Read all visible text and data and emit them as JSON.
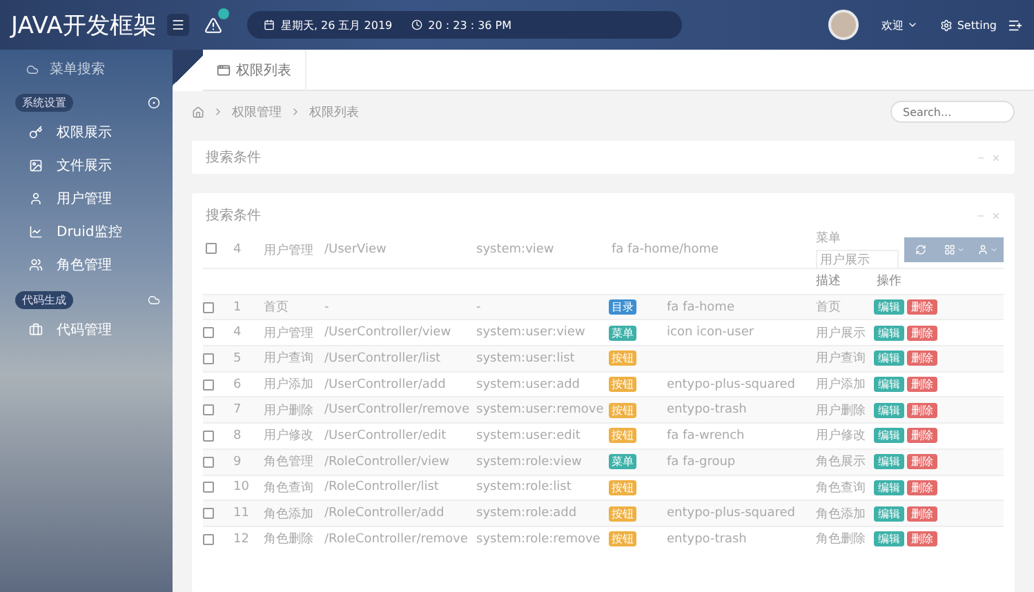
{
  "topbar": {
    "logo": "JAVA开发框架",
    "date": "星期天, 26 五月 2019",
    "time": "20 : 23 : 36 PM",
    "greeting": "欢迎",
    "setting": "Setting"
  },
  "sidebar": {
    "search_label": "菜单搜索",
    "sections": [
      {
        "title": "系统设置",
        "items": [
          {
            "label": "权限展示"
          },
          {
            "label": "文件展示"
          },
          {
            "label": "用户管理"
          },
          {
            "label": "Druid监控"
          },
          {
            "label": "角色管理"
          }
        ]
      },
      {
        "title": "代码生成",
        "items": [
          {
            "label": "代码管理"
          }
        ]
      }
    ]
  },
  "tab": "权限列表",
  "breadcrumb": [
    "权限管理",
    "权限列表"
  ],
  "search": {
    "placeholder": "Search..."
  },
  "panels": [
    "搜索条件",
    "搜索条件"
  ],
  "table": {
    "floating_row": [
      "4",
      "用户管理",
      "/UserView",
      "system:view",
      "fa fa-home/home"
    ],
    "floating_checked": false,
    "menu_label": "菜单",
    "menu_value": "用户展示",
    "columns": [
      "描述",
      "操作"
    ],
    "rows": [
      {
        "id": "1",
        "checked": false,
        "name": "首页",
        "url": "-",
        "perms": "-",
        "type": {
          "label": "目录",
          "kind": "dir"
        },
        "icon": "fa fa-home",
        "desc": "首页",
        "actions": [
          "编辑",
          "删除"
        ]
      },
      {
        "id": "4",
        "checked": false,
        "name": "用户管理",
        "url": "/UserController/view",
        "perms": "system:user:view",
        "type": {
          "label": "菜单",
          "kind": "menu"
        },
        "icon": "icon icon-user",
        "desc": "用户展示",
        "actions": [
          "编辑",
          "删除"
        ]
      },
      {
        "id": "5",
        "checked": false,
        "name": "用户查询",
        "url": "/UserController/list",
        "perms": "system:user:list",
        "type": {
          "label": "按钮",
          "kind": "button"
        },
        "desc": "用户查询",
        "actions": [
          "编辑",
          "删除"
        ]
      },
      {
        "id": "6",
        "checked": false,
        "name": "用户添加",
        "url": "/UserController/add",
        "perms": "system:user:add",
        "type": {
          "label": "按钮",
          "kind": "button"
        },
        "icon": "entypo-plus-squared",
        "desc": "用户添加",
        "actions": [
          "编辑",
          "删除"
        ]
      },
      {
        "id": "7",
        "checked": false,
        "name": "用户删除",
        "url": "/UserController/remove",
        "perms": "system:user:remove",
        "type": {
          "label": "按钮",
          "kind": "button"
        },
        "icon": "entypo-trash",
        "desc": "用户删除",
        "actions": [
          "编辑",
          "删除"
        ]
      },
      {
        "id": "8",
        "checked": false,
        "name": "用户修改",
        "url": "/UserController/edit",
        "perms": "system:user:edit",
        "type": {
          "label": "按钮",
          "kind": "button"
        },
        "icon": "fa fa-wrench",
        "desc": "用户修改",
        "actions": [
          "编辑",
          "删除"
        ]
      },
      {
        "id": "9",
        "checked": false,
        "name": "角色管理",
        "url": "/RoleController/view",
        "perms": "system:role:view",
        "type": {
          "label": "菜单",
          "kind": "menu"
        },
        "icon": "fa fa-group",
        "desc": "角色展示",
        "actions": [
          "编辑",
          "删除"
        ]
      },
      {
        "id": "10",
        "checked": false,
        "name": "角色查询",
        "url": "/RoleController/list",
        "perms": "system:role:list",
        "type": {
          "label": "按钮",
          "kind": "button"
        },
        "desc": "角色查询",
        "actions": [
          "编辑",
          "删除"
        ]
      },
      {
        "id": "11",
        "checked": false,
        "name": "角色添加",
        "url": "/RoleController/add",
        "perms": "system:role:add",
        "type": {
          "label": "按钮",
          "kind": "button"
        },
        "icon": "entypo-plus-squared",
        "desc": "角色添加",
        "actions": [
          "编辑",
          "删除"
        ]
      },
      {
        "id": "12",
        "checked": false,
        "name": "角色删除",
        "url": "/RoleController/remove",
        "perms": "system:role:remove",
        "type": {
          "label": "按钮",
          "kind": "button"
        },
        "icon": "entypo-trash",
        "desc": "角色删除",
        "actions": [
          "编辑",
          "删除"
        ]
      }
    ]
  }
}
